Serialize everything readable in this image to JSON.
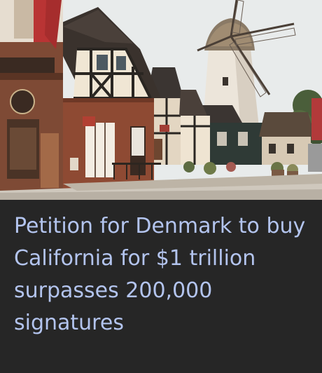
{
  "article": {
    "headline": "Petition for Denmark to buy California for $1 trillion surpasses 200,000 signatures"
  },
  "image": {
    "subject": "solvang-street-with-windmill-image"
  },
  "colors": {
    "background": "#262626",
    "headline_text": "#b3c4ee",
    "sky": "#e9ecec",
    "brick": "#8e4a33",
    "timber": "#2a2622",
    "plaster": "#efe4d2",
    "roof": "#3b3532",
    "windmill": "#ebe5dc"
  }
}
